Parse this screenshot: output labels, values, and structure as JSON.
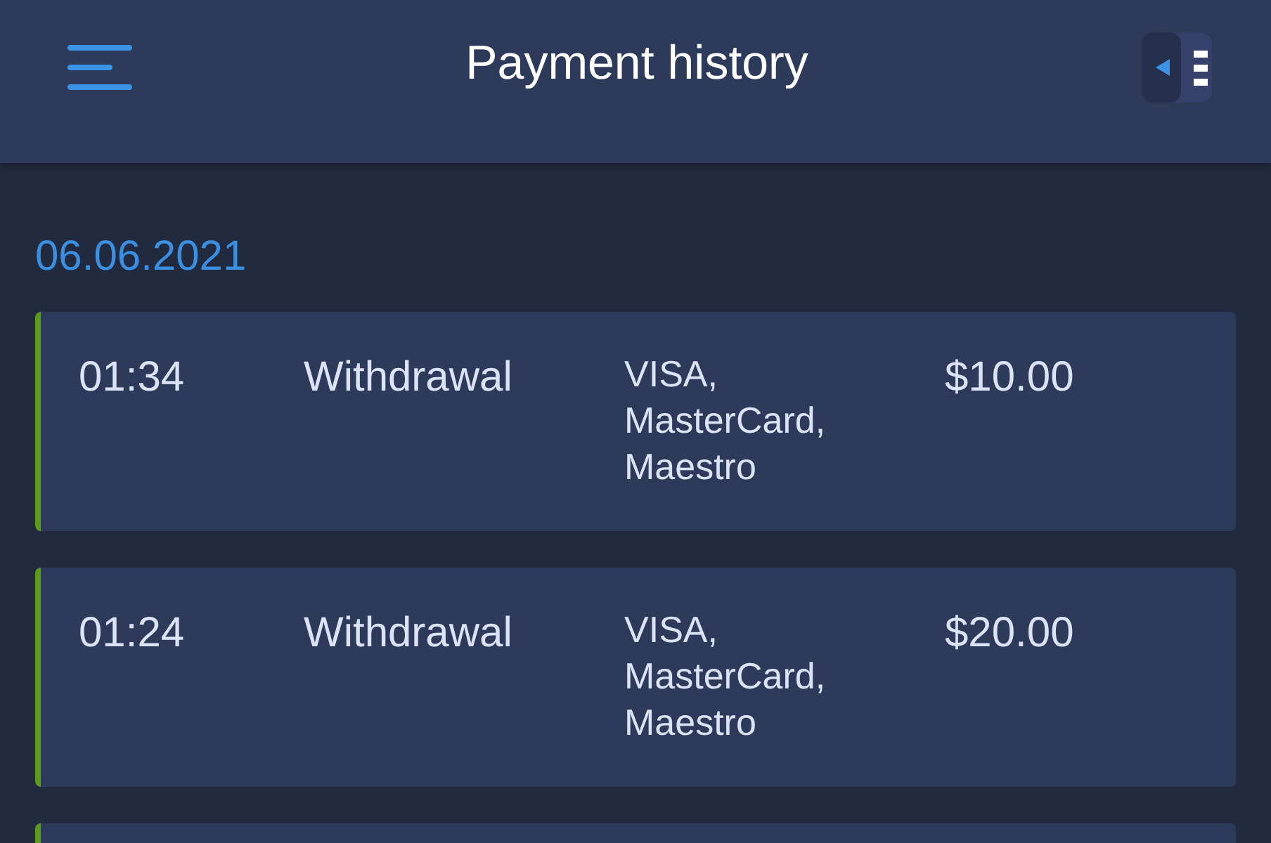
{
  "header": {
    "title": "Payment history"
  },
  "groups": [
    {
      "date": "06.06.2021",
      "transactions": [
        {
          "time": "01:34",
          "type": "Withdrawal",
          "methods": "VISA,\nMasterCard,\nMaestro",
          "amount": "$10.00",
          "color": "#5c9a1c"
        },
        {
          "time": "01:24",
          "type": "Withdrawal",
          "methods": "VISA,\nMasterCard,\nMaestro",
          "amount": "$20.00",
          "color": "#5c9a1c"
        },
        {
          "color": "#5c9a1c"
        }
      ]
    }
  ]
}
